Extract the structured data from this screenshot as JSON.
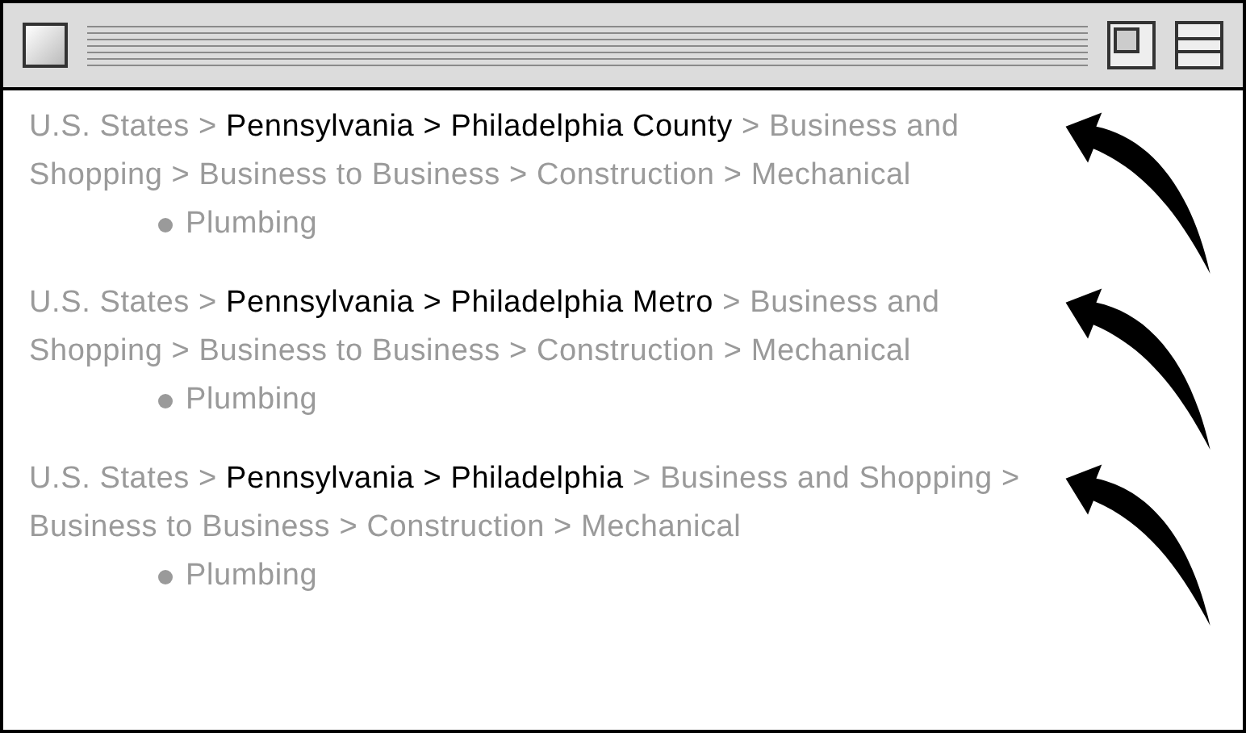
{
  "entries": [
    {
      "segments": [
        {
          "text": "U.S. States",
          "highlighted": false
        },
        {
          "text": ">",
          "highlighted": false
        },
        {
          "text": "Pennsylvania",
          "highlighted": true
        },
        {
          "text": ">",
          "highlighted": true
        },
        {
          "text": "Philadelphia County",
          "highlighted": true
        },
        {
          "text": ">",
          "highlighted": false
        },
        {
          "text": "Business and Shopping",
          "highlighted": false
        },
        {
          "text": ">",
          "highlighted": false
        },
        {
          "text": "Business to Business",
          "highlighted": false
        },
        {
          "text": ">",
          "highlighted": false
        },
        {
          "text": "Construction",
          "highlighted": false
        },
        {
          "text": ">",
          "highlighted": false
        },
        {
          "text": "Mechanical",
          "highlighted": false
        }
      ],
      "item": "Plumbing"
    },
    {
      "segments": [
        {
          "text": "U.S. States",
          "highlighted": false
        },
        {
          "text": ">",
          "highlighted": false
        },
        {
          "text": "Pennsylvania",
          "highlighted": true
        },
        {
          "text": ">",
          "highlighted": true
        },
        {
          "text": "Philadelphia Metro",
          "highlighted": true
        },
        {
          "text": ">",
          "highlighted": false
        },
        {
          "text": "Business and Shopping",
          "highlighted": false
        },
        {
          "text": ">",
          "highlighted": false
        },
        {
          "text": "Business to Business",
          "highlighted": false
        },
        {
          "text": ">",
          "highlighted": false
        },
        {
          "text": "Construction",
          "highlighted": false
        },
        {
          "text": ">",
          "highlighted": false
        },
        {
          "text": "Mechanical",
          "highlighted": false
        }
      ],
      "item": "Plumbing"
    },
    {
      "segments": [
        {
          "text": "U.S. States",
          "highlighted": false
        },
        {
          "text": ">",
          "highlighted": false
        },
        {
          "text": "Pennsylvania",
          "highlighted": true
        },
        {
          "text": ">",
          "highlighted": true
        },
        {
          "text": "Philadelphia",
          "highlighted": true
        },
        {
          "text": ">",
          "highlighted": false
        },
        {
          "text": "Business and Shopping",
          "highlighted": false
        },
        {
          "text": ">",
          "highlighted": false
        },
        {
          "text": "Business to Business",
          "highlighted": false
        },
        {
          "text": ">",
          "highlighted": false
        },
        {
          "text": "Construction",
          "highlighted": false
        },
        {
          "text": ">",
          "highlighted": false
        },
        {
          "text": "Mechanical",
          "highlighted": false
        }
      ],
      "item": "Plumbing"
    }
  ]
}
